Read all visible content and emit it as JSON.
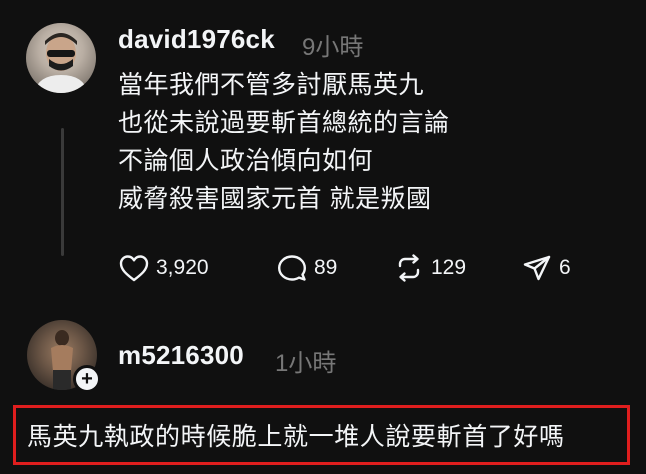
{
  "post": {
    "username": "david1976ck",
    "time": "9小時",
    "avatar_icon": "profile-photo-masked-man",
    "lines": [
      "當年我們不管多討厭馬英九",
      "也從未說過要斬首總統的言論",
      "不論個人政治傾向如何",
      "威脅殺害國家元首 就是叛國"
    ],
    "actions": {
      "likes": "3,920",
      "comments": "89",
      "reposts": "129",
      "shares": "6"
    }
  },
  "reply": {
    "username": "m5216300",
    "time": "1小時",
    "avatar_icon": "profile-photo-shirtless-man",
    "follow_icon": "plus",
    "text": "馬英九執政的時候脆上就一堆人說要斬首了好嗎"
  },
  "colors": {
    "background": "#101010",
    "text": "#f3f5f7",
    "muted": "#777777",
    "highlight_border": "#e01e1e"
  }
}
